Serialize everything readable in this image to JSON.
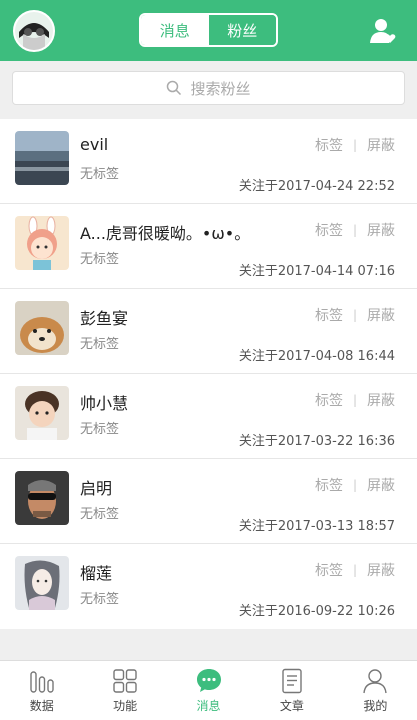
{
  "header": {
    "tabs": [
      {
        "label": "消息",
        "active": false
      },
      {
        "label": "粉丝",
        "active": true
      }
    ]
  },
  "search": {
    "placeholder": "搜索粉丝"
  },
  "fans": [
    {
      "name": "evil",
      "tag": "无标签",
      "action_tag": "标签",
      "action_block": "屏蔽",
      "followed_at": "关注于2017-04-24 22:52"
    },
    {
      "name": "A...虎哥很暖呦。•ω•。",
      "tag": "无标签",
      "action_tag": "标签",
      "action_block": "屏蔽",
      "followed_at": "关注于2017-04-14 07:16"
    },
    {
      "name": "彭鱼宴",
      "tag": "无标签",
      "action_tag": "标签",
      "action_block": "屏蔽",
      "followed_at": "关注于2017-04-08 16:44"
    },
    {
      "name": "帅小慧",
      "tag": "无标签",
      "action_tag": "标签",
      "action_block": "屏蔽",
      "followed_at": "关注于2017-03-22 16:36"
    },
    {
      "name": "启明",
      "tag": "无标签",
      "action_tag": "标签",
      "action_block": "屏蔽",
      "followed_at": "关注于2017-03-13 18:57"
    },
    {
      "name": "榴莲",
      "tag": "无标签",
      "action_tag": "标签",
      "action_block": "屏蔽",
      "followed_at": "关注于2016-09-22 10:26"
    }
  ],
  "tabbar": [
    {
      "label": "数据",
      "icon": "bar-chart-icon",
      "active": false
    },
    {
      "label": "功能",
      "icon": "grid-icon",
      "active": false
    },
    {
      "label": "消息",
      "icon": "chat-bubble-icon",
      "active": true
    },
    {
      "label": "文章",
      "icon": "document-icon",
      "active": false
    },
    {
      "label": "我的",
      "icon": "person-icon",
      "active": false
    }
  ],
  "colors": {
    "accent": "#3dbd7e",
    "background": "#efefef"
  }
}
